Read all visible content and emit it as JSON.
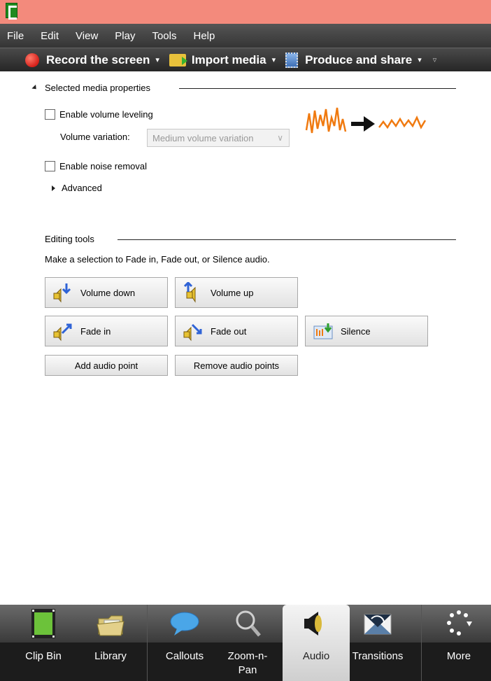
{
  "menu": [
    "File",
    "Edit",
    "View",
    "Play",
    "Tools",
    "Help"
  ],
  "toolbar": {
    "record": "Record the screen",
    "import": "Import media",
    "produce": "Produce and share",
    "caret": "▾",
    "overflow": "▿"
  },
  "properties": {
    "title": "Selected media properties",
    "volume_leveling": "Enable volume leveling",
    "volume_variation_label": "Volume variation:",
    "volume_variation_value": "Medium volume variation",
    "select_arrow": "∨",
    "noise_removal": "Enable noise removal",
    "advanced": "Advanced"
  },
  "editing": {
    "title": "Editing tools",
    "help": "Make a selection to Fade in, Fade out, or Silence audio.",
    "volume_down": "Volume down",
    "volume_up": "Volume up",
    "fade_in": "Fade in",
    "fade_out": "Fade out",
    "silence": "Silence",
    "add_point": "Add audio point",
    "remove_points": "Remove audio points"
  },
  "tabs": [
    {
      "label": "Clip Bin"
    },
    {
      "label": "Library"
    },
    {
      "label": "Callouts"
    },
    {
      "label": "Zoom-n-\nPan"
    },
    {
      "label": "Audio"
    },
    {
      "label": "Transitions"
    },
    {
      "label": "More"
    }
  ],
  "colors": {
    "titlebar": "#f38a7c",
    "waveform": "#f07a10",
    "active_tab": "#e6e6e6"
  }
}
